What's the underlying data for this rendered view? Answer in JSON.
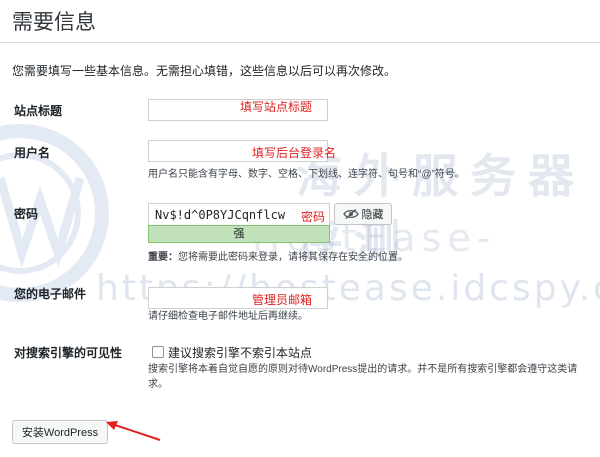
{
  "header": {
    "title": "需要信息"
  },
  "intro": "您需要填写一些基本信息。无需担心填错，这些信息以后可以再次修改。",
  "site_title": {
    "label": "站点标题",
    "annotation": "填写站点标题",
    "value": ""
  },
  "username": {
    "label": "用户名",
    "annotation": "填写后台登录名",
    "value": "",
    "hint": "用户名只能含有字母、数字、空格、下划线、连字符、句号和“@”符号。"
  },
  "password": {
    "label": "密码",
    "value": "Nv$!d^0P8YJCqnflcw",
    "annotation": "密码",
    "strength": "强",
    "hide_label": "隐藏",
    "important_label": "重要：",
    "important_text": "您将需要此密码来登录，请将其保存在安全的位置。"
  },
  "email": {
    "label": "您的电子邮件",
    "annotation": "管理员邮箱",
    "value": "",
    "hint": "请仔细检查电子邮件地址后再继续。"
  },
  "search_visibility": {
    "label": "对搜索引擎的可见性",
    "checkbox_label": "建议搜索引擎不索引本站点",
    "checked": false,
    "hint_line1": "搜索引擎将本着自觉自愿的原则对待WordPress提出的请求。并不是所有搜索引擎都会遵守这类请",
    "hint_line2": "求。"
  },
  "install_button": "安装WordPress",
  "watermark": {
    "brand_cn": "海外服务器评测",
    "brand_en": "-HostEase-",
    "url": "https://hostease.idcspy.com"
  },
  "colors": {
    "annotation": "#e02020",
    "strength_bg": "#c1e1b9",
    "arrow": "#e02020"
  }
}
